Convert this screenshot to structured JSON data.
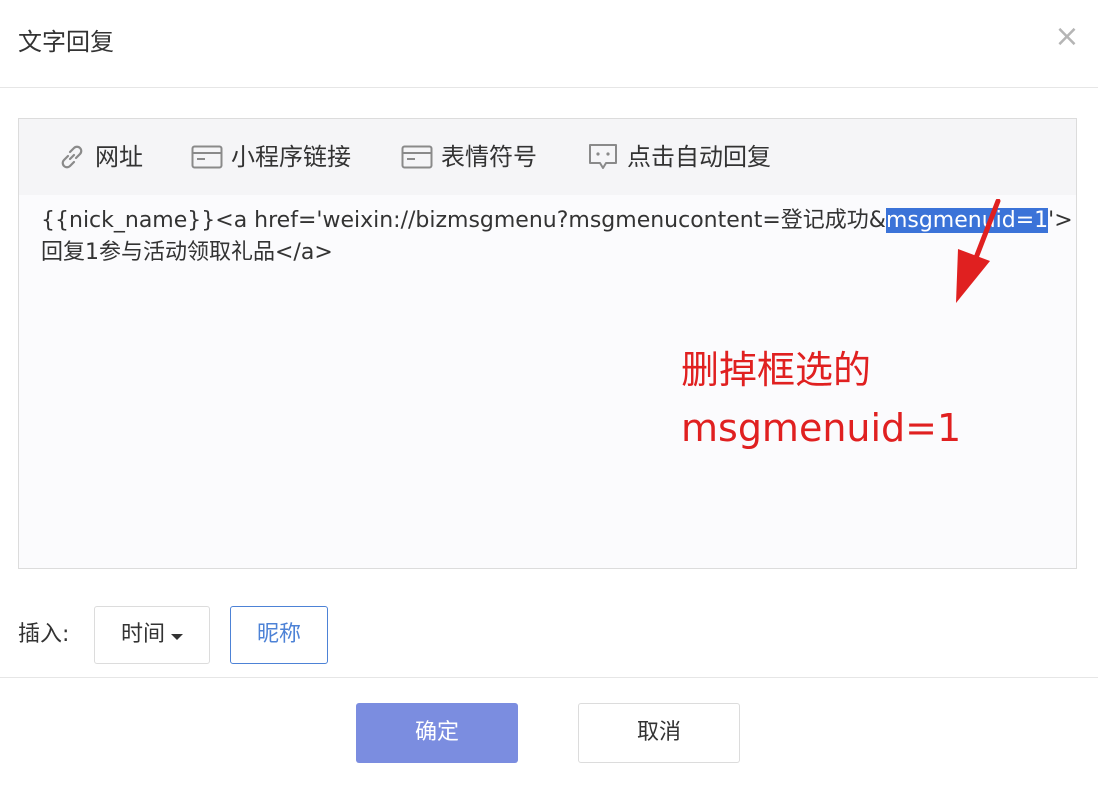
{
  "dialog": {
    "title": "文字回复",
    "close_label": "×"
  },
  "toolbar": {
    "items": [
      {
        "label": "网址",
        "icon": "link-icon"
      },
      {
        "label": "小程序链接",
        "icon": "card-icon"
      },
      {
        "label": "表情符号",
        "icon": "card-icon"
      },
      {
        "label": "点击自动回复",
        "icon": "chat-bubble-icon"
      }
    ]
  },
  "editor": {
    "line1_before": "{{nick_name}}<a href='weixin://bizmsgmenu?msgmenucontent=登记成功&",
    "line1_selected": "msgmenuid=1",
    "line1_after": "'>",
    "line2": "回复1参与活动领取礼品</a>"
  },
  "annotation": {
    "line1": "删掉框选的",
    "line2": "msgmenuid=1",
    "color": "#e02020"
  },
  "insert": {
    "label": "插入:",
    "time_label": "时间",
    "nickname_label": "昵称"
  },
  "footer": {
    "confirm_label": "确定",
    "cancel_label": "取消"
  },
  "colors": {
    "accent": "#4d82d6",
    "confirm": "#7b8de0",
    "selection": "#3b73d8"
  }
}
